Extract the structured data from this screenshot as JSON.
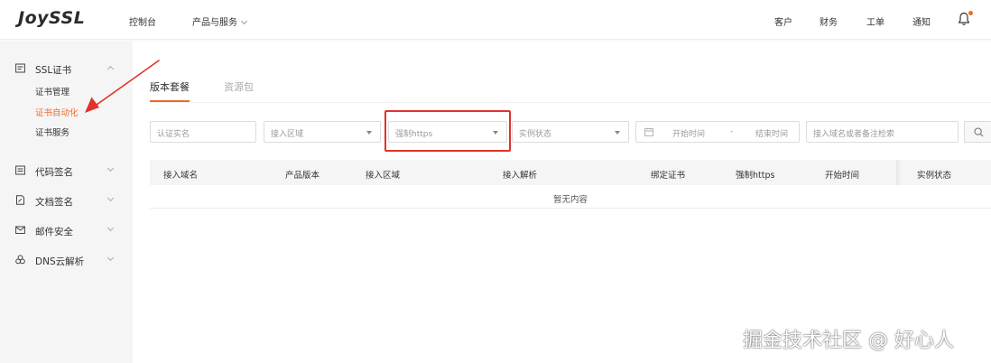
{
  "header": {
    "logo": "JoySSL",
    "nav": {
      "console": "控制台",
      "products": "产品与服务",
      "customer": "客户",
      "finance": "财务",
      "ticket": "工单",
      "notice": "通知"
    }
  },
  "sidebar": {
    "groups": [
      {
        "label": "SSL证书",
        "icon": "certificate-icon",
        "expanded": true,
        "items": [
          "证书管理",
          "证书自动化",
          "证书服务"
        ],
        "active_item": "证书自动化"
      },
      {
        "label": "代码签名",
        "icon": "code-sign-icon",
        "expanded": false
      },
      {
        "label": "文档签名",
        "icon": "document-sign-icon",
        "expanded": false
      },
      {
        "label": "邮件安全",
        "icon": "mail-security-icon",
        "expanded": false
      },
      {
        "label": "DNS云解析",
        "icon": "cloud-dns-icon",
        "expanded": false
      }
    ]
  },
  "tabs": {
    "version": "版本套餐",
    "resource": "资源包"
  },
  "filters": {
    "verified": "认证实名",
    "region": "接入区域",
    "force_https": "强制https",
    "status": "实例状态",
    "start_time": "开始时间",
    "date_sep": "-",
    "end_time": "结束时间",
    "search": "接入域名或者备注检索"
  },
  "table": {
    "columns": [
      "接入域名",
      "产品版本",
      "接入区域",
      "接入解析",
      "绑定证书",
      "强制https",
      "开始时间",
      "实例状态"
    ],
    "empty": "暂无内容"
  },
  "colors": {
    "accent": "#f06a2a",
    "highlight": "#e0322b"
  },
  "watermark": "掘金技术社区 @ 好心人"
}
